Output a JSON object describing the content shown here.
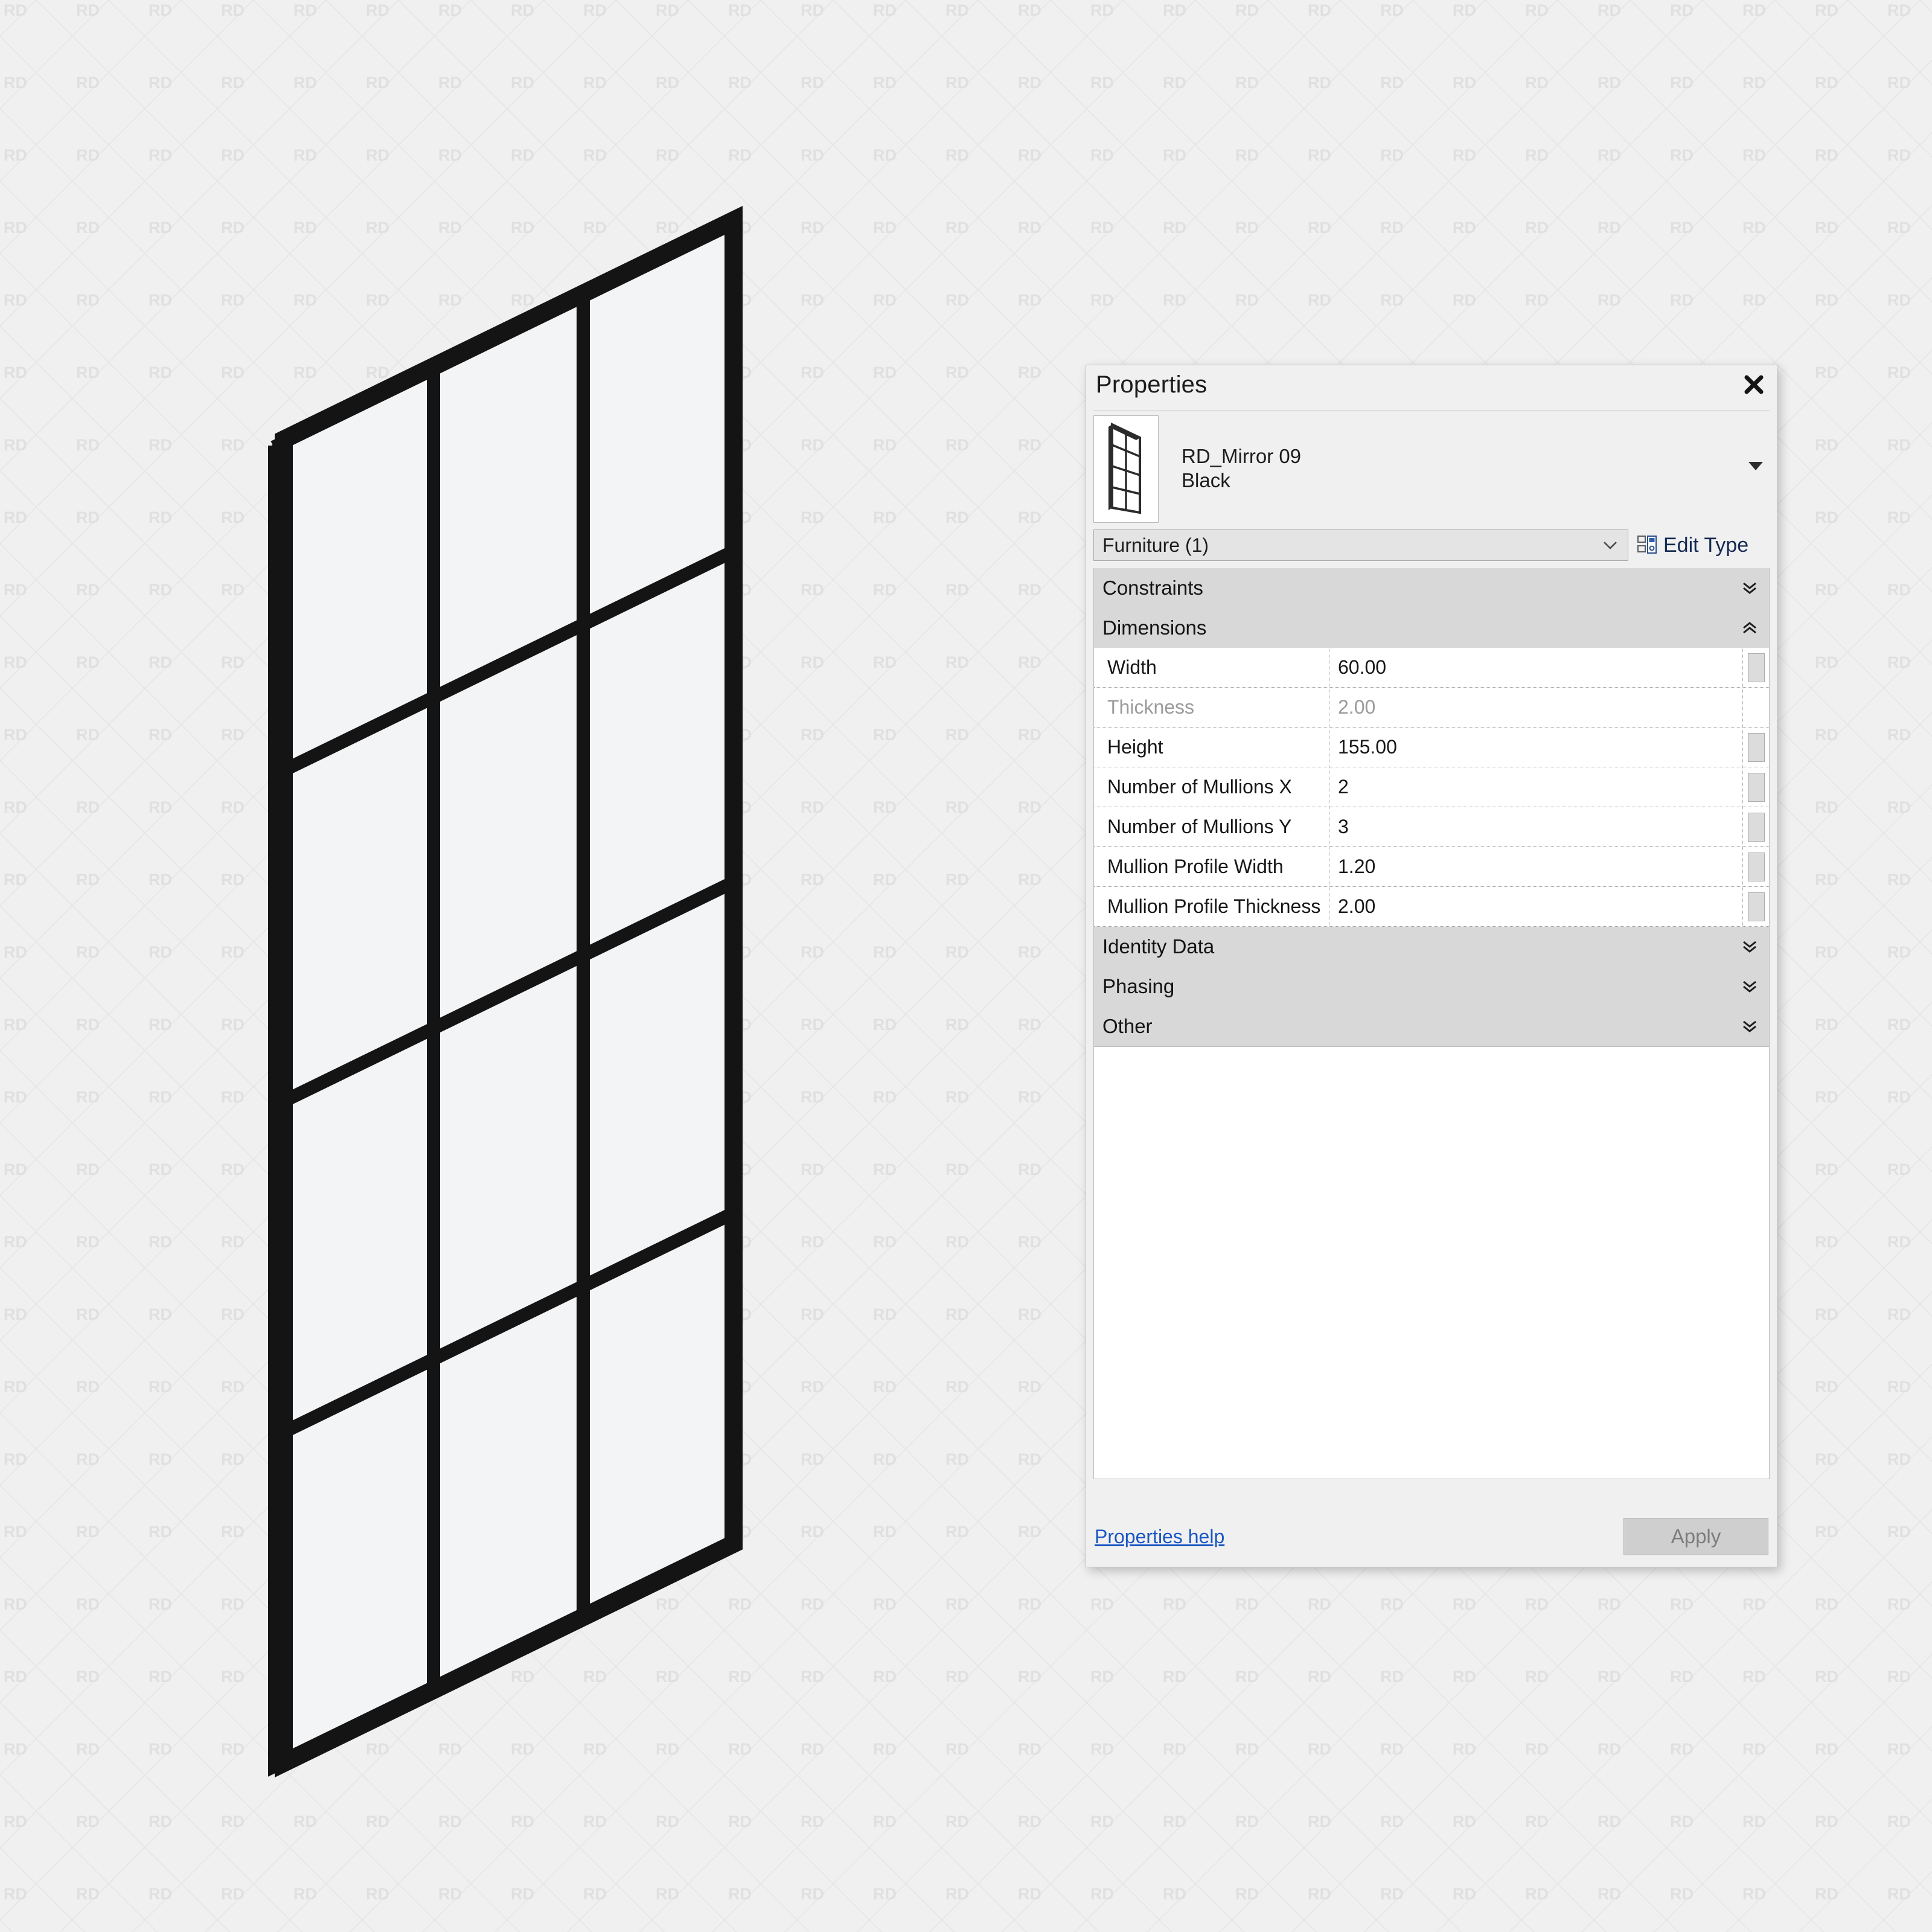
{
  "watermark": {
    "text": "RD",
    "color": "#e0e0e0",
    "line_color": "#e6e6e6",
    "tile": 120
  },
  "canvas": {
    "background": "#f0f0f0",
    "drawing_name": "mirror-axonometric-view",
    "frame_color": "#141414",
    "glass_color": "#f3f4f6"
  },
  "panel": {
    "title": "Properties",
    "close_icon": "close-icon",
    "type": {
      "family": "RD_Mirror 09",
      "type_name": "Black",
      "thumbnail_icon": "mirror-thumbnail",
      "dropdown_icon": "triangle-down-icon"
    },
    "category": {
      "selected": "Furniture (1)",
      "caret_icon": "chevron-down-icon"
    },
    "edit_type": {
      "label": "Edit Type",
      "icon": "edit-type-icon"
    },
    "groups": [
      {
        "label": "Constraints",
        "state": "collapsed",
        "chevron": "double-chevron-down-icon",
        "rows": []
      },
      {
        "label": "Dimensions",
        "state": "expanded",
        "chevron": "double-chevron-up-icon",
        "rows": [
          {
            "name": "Width",
            "value": "60.00",
            "readonly": false,
            "assoc": true
          },
          {
            "name": "Thickness",
            "value": "2.00",
            "readonly": true,
            "assoc": false
          },
          {
            "name": "Height",
            "value": "155.00",
            "readonly": false,
            "assoc": true
          },
          {
            "name": "Number of Mullions X",
            "value": "2",
            "readonly": false,
            "assoc": true
          },
          {
            "name": "Number of Mullions Y",
            "value": "3",
            "readonly": false,
            "assoc": true
          },
          {
            "name": "Mullion Profile Width",
            "value": "1.20",
            "readonly": false,
            "assoc": true
          },
          {
            "name": "Mullion Profile Thickness",
            "value": "2.00",
            "readonly": false,
            "assoc": true
          }
        ]
      },
      {
        "label": "Identity Data",
        "state": "collapsed",
        "chevron": "double-chevron-down-icon",
        "rows": []
      },
      {
        "label": "Phasing",
        "state": "collapsed",
        "chevron": "double-chevron-down-icon",
        "rows": []
      },
      {
        "label": "Other",
        "state": "collapsed",
        "chevron": "double-chevron-down-icon",
        "rows": []
      }
    ],
    "footer": {
      "help_link": "Properties help",
      "apply_label": "Apply"
    }
  },
  "colors": {
    "panel_bg": "#f0f0f0",
    "group_header_bg": "#d8d8d8",
    "link_blue": "#1a56c4",
    "edit_type_blue": "#152a52",
    "disabled_text": "#9b9b9b"
  }
}
